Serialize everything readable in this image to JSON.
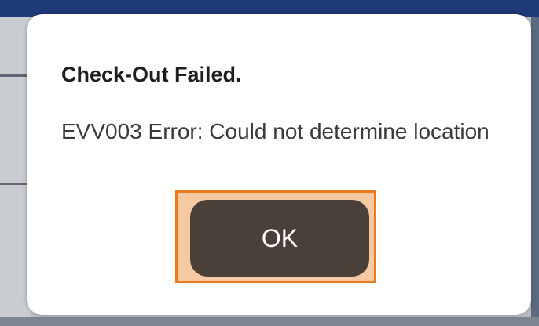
{
  "dialog": {
    "title": "Check-Out Failed.",
    "message": "EVV003 Error: Could not determine location",
    "ok_label": "OK"
  },
  "colors": {
    "backdrop_top": "#1f3a78",
    "dialog_background": "#ffffff",
    "button_background": "#4b3f3a",
    "button_text": "#ffffff",
    "highlight_border": "#ef7a1a",
    "highlight_fill": "#f6c9a3"
  }
}
